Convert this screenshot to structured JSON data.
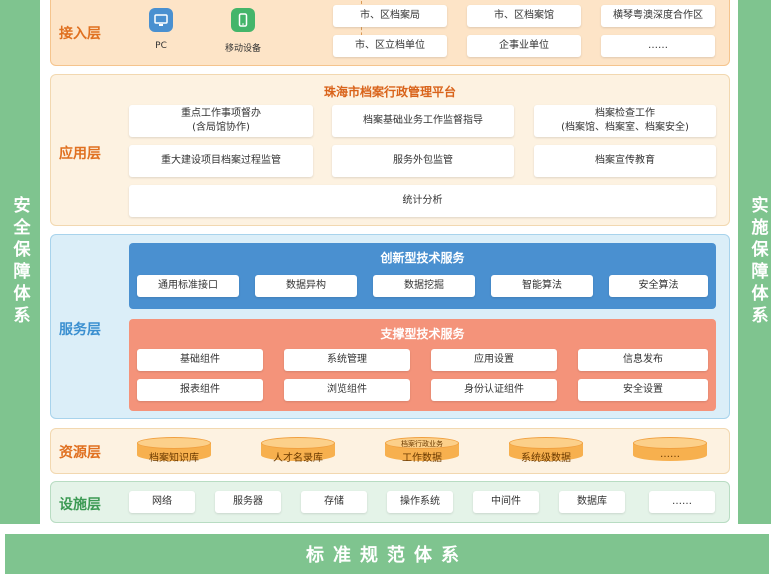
{
  "side": {
    "left": "安全保障体系",
    "right": "实施保障体系"
  },
  "bottom_bar": "标准规范体系",
  "access": {
    "title": "接入层",
    "devices": [
      {
        "label": "PC",
        "icon": "pc-icon"
      },
      {
        "label": "移动设备",
        "icon": "mobile-device-icon"
      }
    ],
    "units": [
      "市、区档案局",
      "市、区档案馆",
      "横琴粤澳深度合作区",
      "市、区立档单位",
      "企事业单位",
      "……"
    ]
  },
  "application": {
    "title": "应用层",
    "platform": "珠海市档案行政管理平台",
    "row1": [
      "重点工作事项督办\n(含局馆协作)",
      "档案基础业务工作监督指导",
      "档案检查工作\n(档案馆、档案室、档案安全)"
    ],
    "row2": [
      "重大建设项目档案过程监管",
      "服务外包监管",
      "档案宣传教育"
    ],
    "row3": "统计分析"
  },
  "service": {
    "title": "服务层",
    "innovative": {
      "title": "创新型技术服务",
      "items": [
        "通用标准接口",
        "数据异构",
        "数据挖掘",
        "智能算法",
        "安全算法"
      ]
    },
    "support": {
      "title": "支撑型技术服务",
      "items": [
        "基础组件",
        "系统管理",
        "应用设置",
        "信息发布",
        "报表组件",
        "浏览组件",
        "身份认证组件",
        "安全设置"
      ]
    }
  },
  "resource": {
    "title": "资源层",
    "items": [
      {
        "top": "",
        "label": "档案知识库"
      },
      {
        "top": "",
        "label": "人才名录库"
      },
      {
        "top": "档案行政业务",
        "label": "工作数据"
      },
      {
        "top": "",
        "label": "系统级数据"
      },
      {
        "top": "",
        "label": "……"
      }
    ]
  },
  "infrastructure": {
    "title": "设施层",
    "items": [
      "网络",
      "服务器",
      "存储",
      "操作系统",
      "中间件",
      "数据库",
      "……"
    ]
  },
  "colors": {
    "green": "#7fc48f",
    "orange": "#e07020",
    "blue": "#4a90d0",
    "salmon": "#f4937a"
  }
}
